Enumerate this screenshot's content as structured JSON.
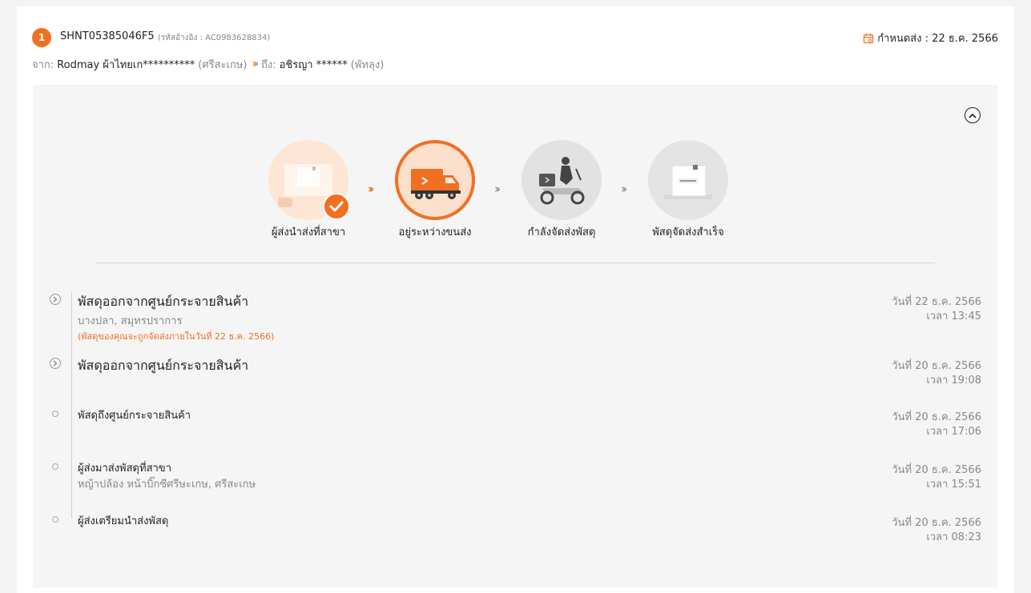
{
  "header": {
    "badge_number": "1",
    "tracking_no": "SHNT05385046F5",
    "reference": "(รหัสอ้างอิง : AC0983628834)",
    "due_date": "กำหนดส่ง : 22 ธ.ค. 2566",
    "from_label": "จาก:",
    "from_name": "Rodmay ผ้าไทยเก**********",
    "from_province": "(ศรีสะเกษ)",
    "to_label": "ถึง:",
    "to_name": "อชิรญา ******",
    "to_province": "(พัทลุง)"
  },
  "colors": {
    "accent": "#f26f21",
    "panel_bg": "#f5f5f5"
  },
  "steps": [
    {
      "label": "ผู้ส่งนำส่งที่สาขา",
      "state": "done",
      "icon": "box-icon"
    },
    {
      "label": "อยู่ระหว่างขนส่ง",
      "state": "current",
      "icon": "truck-icon"
    },
    {
      "label": "กำลังจัดส่งพัสดุ",
      "state": "pending",
      "icon": "scooter-icon"
    },
    {
      "label": "พัสดุจัดส่งสำเร็จ",
      "state": "pending",
      "icon": "package-icon"
    }
  ],
  "events": [
    {
      "title": "พัสดุออกจากศูนย์กระจายสินค้า",
      "sub": "บางปลา, สมุทรปราการ",
      "note": "(พัสดุของคุณจะถูกจัดส่งภายในวันที่ 22 ธ.ค. 2566)",
      "date": "วันที่ 22 ธ.ค. 2566",
      "time": "เวลา 13:45"
    },
    {
      "title": "พัสดุออกจากศูนย์กระจายสินค้า",
      "date": "วันที่ 20 ธ.ค. 2566",
      "time": "เวลา 19:08"
    },
    {
      "title": "พัสดุถึงศูนย์กระจายสินค้า",
      "date": "วันที่ 20 ธ.ค. 2566",
      "time": "เวลา 17:06"
    },
    {
      "title": "ผู้ส่งมาส่งพัสดุที่สาขา",
      "sub": "หญ้าปล้อง หน้าบิ๊กซีศรีษะเกษ, ศรีสะเกษ",
      "date": "วันที่ 20 ธ.ค. 2566",
      "time": "เวลา 15:51"
    },
    {
      "title": "ผู้ส่งเตรียมนำส่งพัสดุ",
      "date": "วันที่ 20 ธ.ค. 2566",
      "time": "เวลา 08:23"
    }
  ]
}
